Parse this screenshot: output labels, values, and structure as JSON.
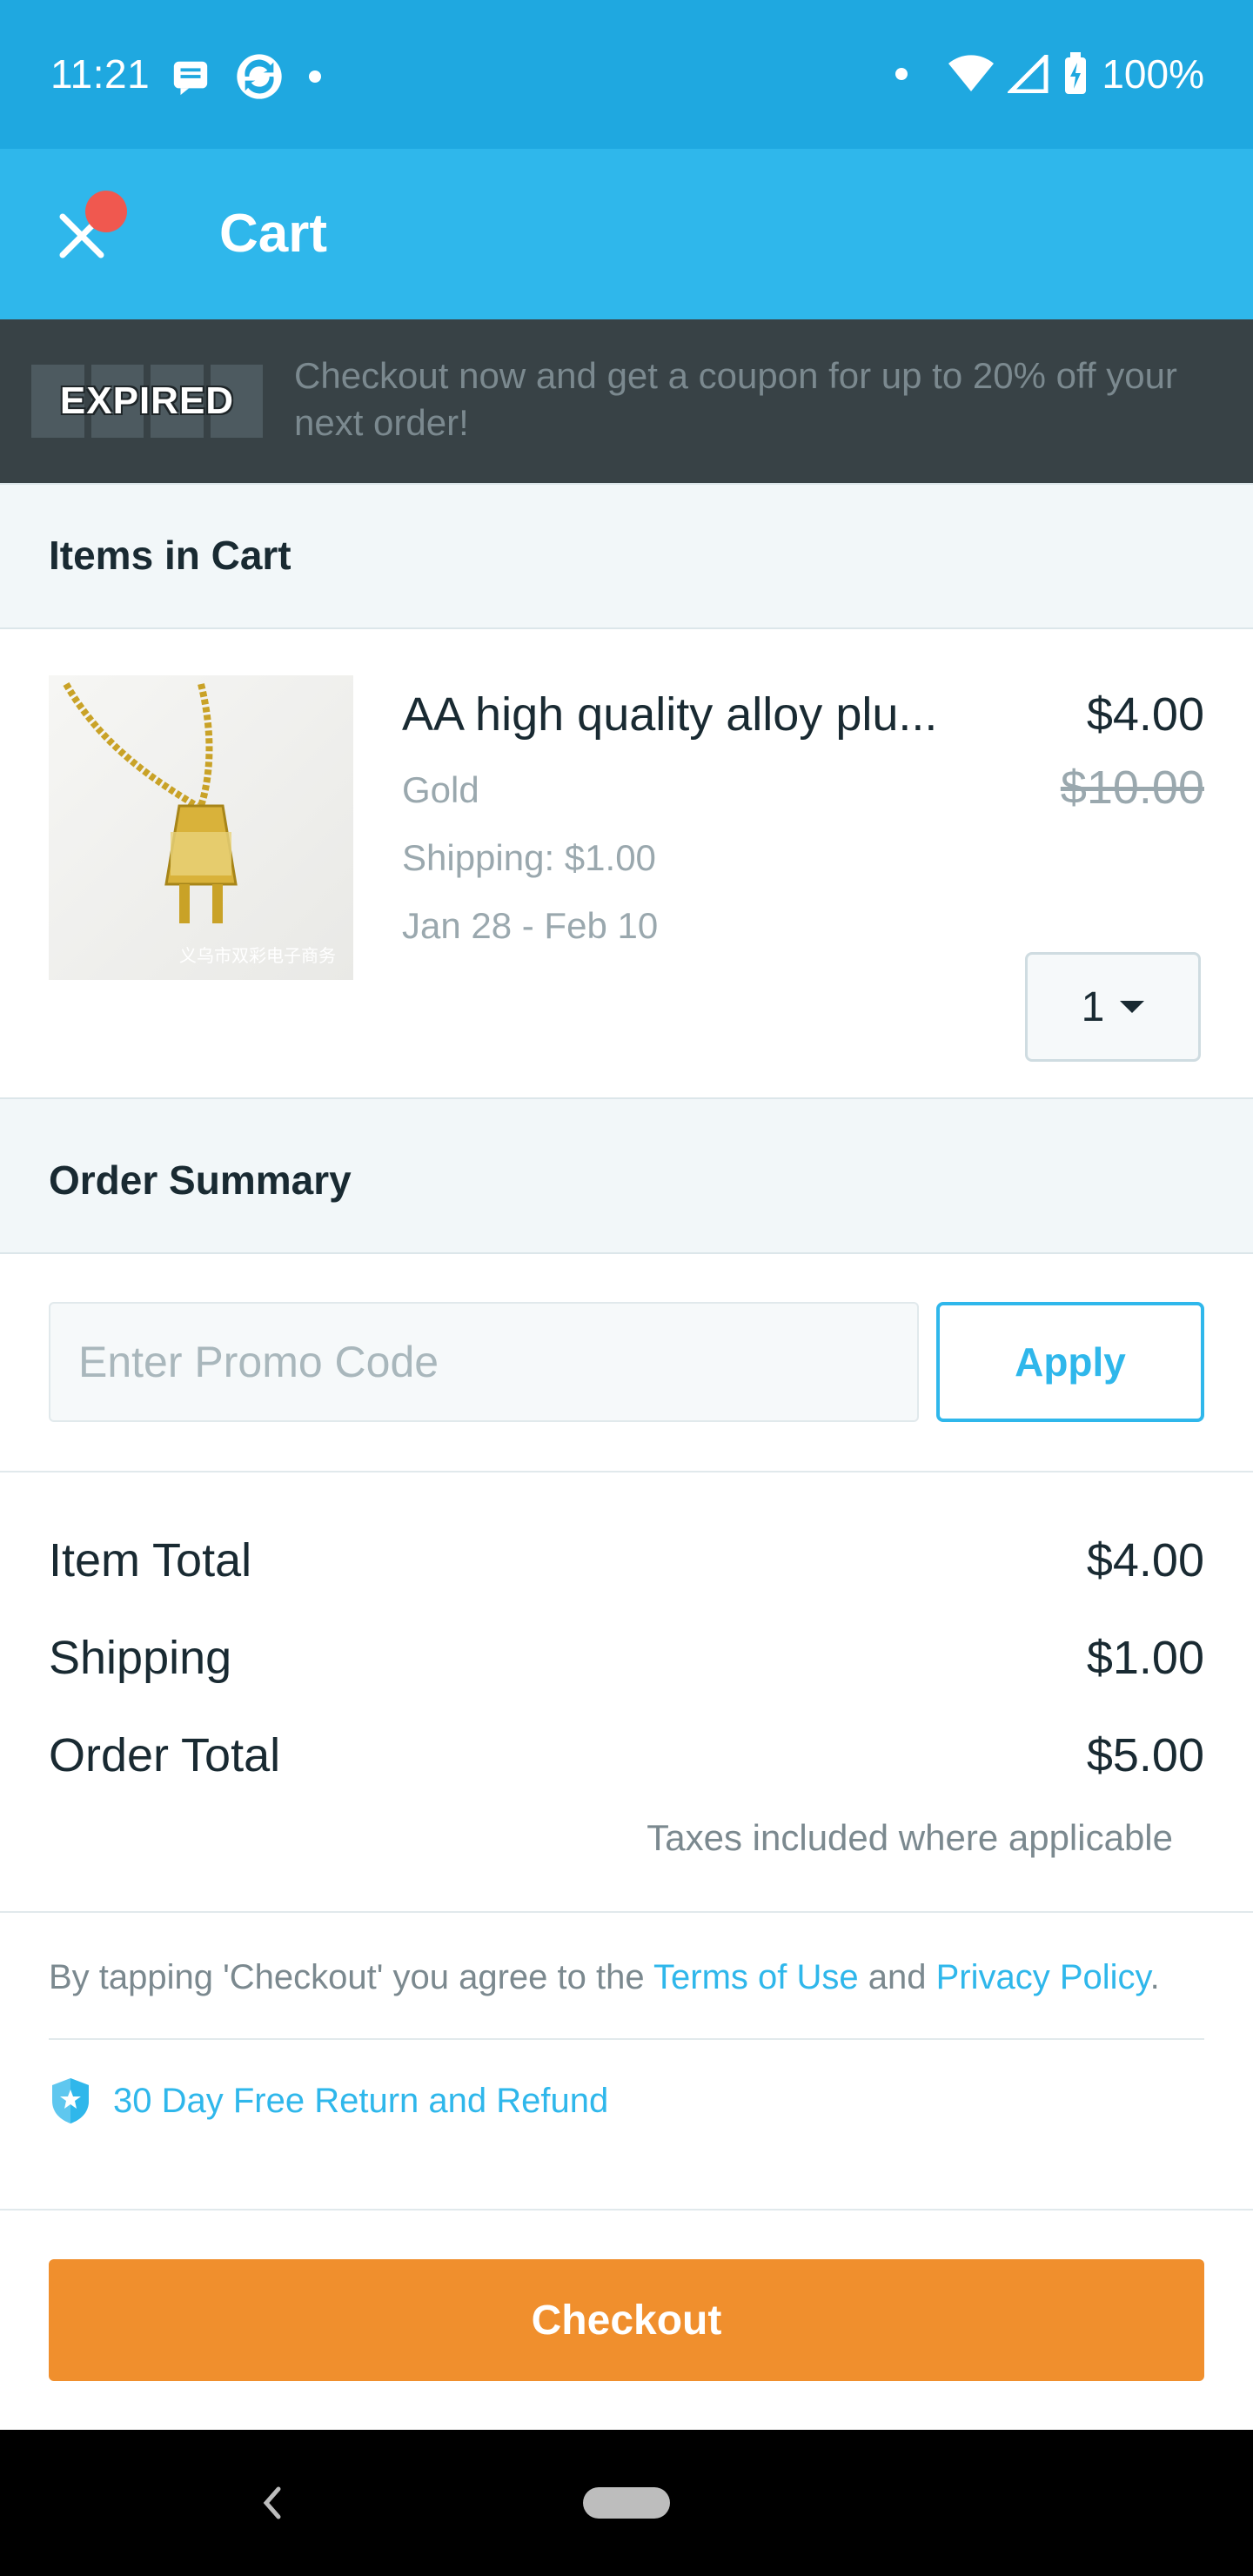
{
  "status_bar": {
    "time": "11:21",
    "battery": "100%",
    "icons": [
      "message-icon",
      "sync-icon",
      "dot-icon",
      "wifi-icon",
      "signal-icon",
      "battery-charging-icon"
    ]
  },
  "app_bar": {
    "title": "Cart",
    "close_icon": "close-icon"
  },
  "banner": {
    "badge": "EXPIRED",
    "message": "Checkout now and get a coupon for up to 20% off your next order!"
  },
  "items_section": {
    "title": "Items in Cart"
  },
  "cart_item": {
    "name": "AA high quality alloy plu...",
    "variant": "Gold",
    "shipping": "Shipping: $1.00",
    "delivery": "Jan 28 - Feb 10",
    "price": "$4.00",
    "original_price": "$10.00",
    "quantity": "1",
    "image_watermark": "义乌市双彩电子商务"
  },
  "summary_section": {
    "title": "Order Summary"
  },
  "promo": {
    "placeholder": "Enter Promo Code",
    "value": "",
    "apply_label": "Apply"
  },
  "totals": {
    "item_total_label": "Item Total",
    "item_total_value": "$4.00",
    "shipping_label": "Shipping",
    "shipping_value": "$1.00",
    "order_total_label": "Order Total",
    "order_total_value": "$5.00",
    "tax_note": "Taxes included where applicable"
  },
  "terms": {
    "prefix": "By tapping 'Checkout' you agree to the ",
    "terms_link": "Terms of Use",
    "and": " and ",
    "privacy_link": "Privacy Policy",
    "suffix": "."
  },
  "guarantee": {
    "label": "30 Day Free Return and Refund",
    "icon": "shield-star-icon"
  },
  "checkout": {
    "label": "Checkout",
    "color": "#f08f2d"
  },
  "colors": {
    "status_bar": "#1fa8e0",
    "app_bar": "#2fb7eb",
    "banner": "#384246",
    "accent": "#2fb7eb",
    "notification_dot": "#f0584f"
  }
}
